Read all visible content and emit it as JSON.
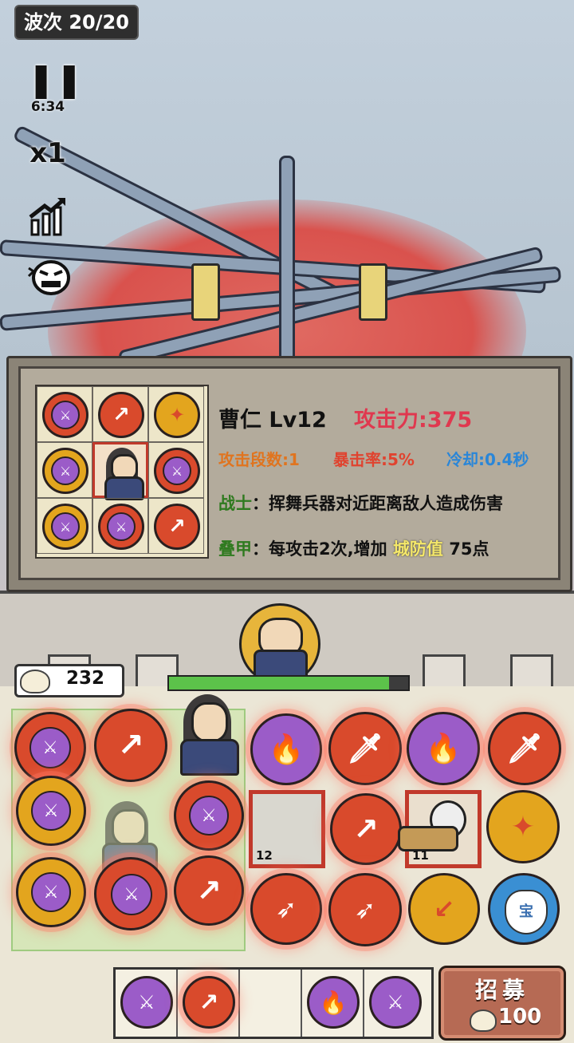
{
  "hud": {
    "wave_label": "波次 20/20",
    "pause_icon": "pause-icon",
    "timer": "6:34",
    "speed": "x1",
    "chart_icon": "chart-up-icon",
    "rage_icon": "angry-face-icon"
  },
  "info_panel": {
    "hero_name": "曹仁 Lv12",
    "attack": "攻击力:375",
    "stats": [
      {
        "text": "攻击段数:1",
        "color": "#e0741f"
      },
      {
        "text": "暴击率:5%",
        "color": "#e0432f"
      },
      {
        "text": "冷却:0.4秒",
        "color": "#2a86d8"
      }
    ],
    "trait1": {
      "tag": "战士",
      "sep": "：",
      "desc": "挥舞兵器对近距离敌人造成伤害"
    },
    "trait2": {
      "tag": "叠甲",
      "sep": "：",
      "desc_a": "每攻击2次,增加",
      "highlight": "城防值",
      "desc_b": "75点"
    },
    "mini_grid": [
      [
        "purple-sword-boost",
        "red-arrow",
        "yellow-spread"
      ],
      [
        "yellow-sword-boost",
        "hero",
        "purple-sword-boost"
      ],
      [
        "yellow-sword-boost",
        "red-sword-boost",
        "red-arrow"
      ]
    ]
  },
  "resources": {
    "buns": "232",
    "wall_hp_fraction": 0.92
  },
  "board": {
    "slot_levels": [
      "12",
      "11"
    ]
  },
  "recruit": {
    "label": "招募",
    "cost": "100"
  },
  "colors": {
    "red_orb": "#d94a2c",
    "yellow_orb": "#e3a51e",
    "purple_orb": "#9b5cc8",
    "blue_orb": "#3a8fd3",
    "panel": "#b3ab9c"
  }
}
